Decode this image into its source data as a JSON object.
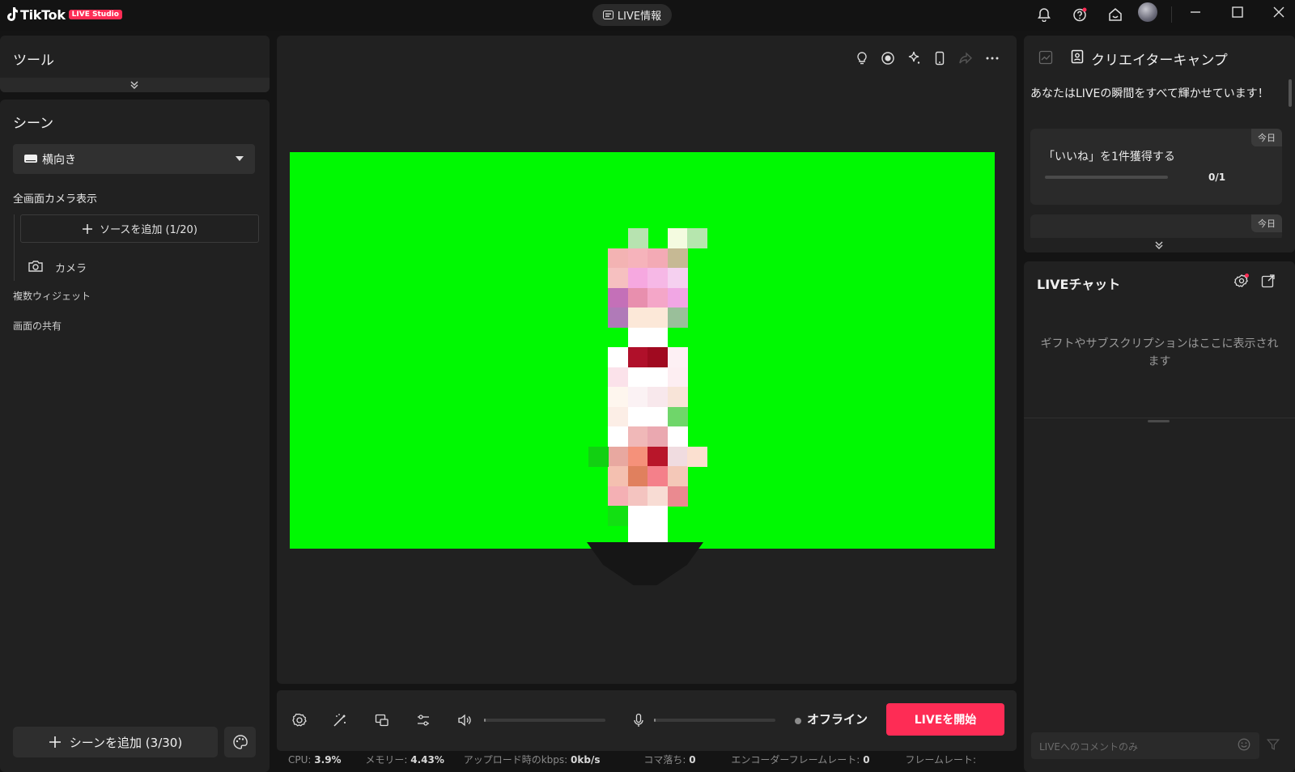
{
  "app": {
    "brand": "TikTok",
    "badge": "LIVE Studio",
    "live_info_label": "LIVE情報"
  },
  "colors": {
    "accent": "#fe2c55",
    "background": "#141414",
    "panel": "#212121",
    "greenscreen": "#00f902"
  },
  "titlebar_icons": [
    "bell-icon",
    "help-icon",
    "home-icon",
    "avatar",
    "minimize-icon",
    "maximize-icon",
    "close-icon"
  ],
  "tools": {
    "title": "ツール"
  },
  "scenes": {
    "title": "シーン",
    "selected_scene": "横向き",
    "group_title": "全画面カメラ表示",
    "add_source_label": "ソースを追加 (1/20)",
    "sources": [
      {
        "icon": "camera-icon",
        "label": "カメラ"
      }
    ],
    "other_groups": [
      "複数ウィジェット",
      "画面の共有"
    ],
    "add_scene_label": "シーンを追加 (3/30)"
  },
  "preview_toolbar_icons": [
    "lightbulb-icon",
    "record-icon",
    "sparkle-icon",
    "phone-icon",
    "share-icon",
    "more-icon"
  ],
  "controls": {
    "icons": [
      "settings-icon",
      "magic-wand-icon",
      "layout-icon",
      "sliders-icon",
      "speaker-icon",
      "mic-icon"
    ],
    "speaker_level": 0,
    "mic_level": 0,
    "status_label": "オフライン",
    "start_live_label": "LIVEを開始"
  },
  "stats": {
    "cpu_label": "CPU:",
    "cpu_value": "3.9%",
    "memory_label": "メモリー:",
    "memory_value": "4.43%",
    "upload_label": "アップロード時のkbps:",
    "upload_value": "0kb/s",
    "dropped_label": "コマ落ち:",
    "dropped_value": "0",
    "encoder_fps_label": "エンコーダーフレームレート:",
    "encoder_fps_value": "0",
    "fps_label": "フレームレート:"
  },
  "creator_camp": {
    "title": "クリエイターキャンプ",
    "message": "あなたはLIVEの瞬間をすべて輝かせています！",
    "tasks": [
      {
        "tag": "今日",
        "title": "「いいね」を1件獲得する",
        "progress": "0/1",
        "progress_fraction": 0
      },
      {
        "tag": "今日"
      }
    ]
  },
  "live_chat": {
    "title": "LIVEチャット",
    "empty_message": "ギフトやサブスクリプションはここに表示されます",
    "comment_placeholder": "LIVEへのコメントのみ"
  }
}
